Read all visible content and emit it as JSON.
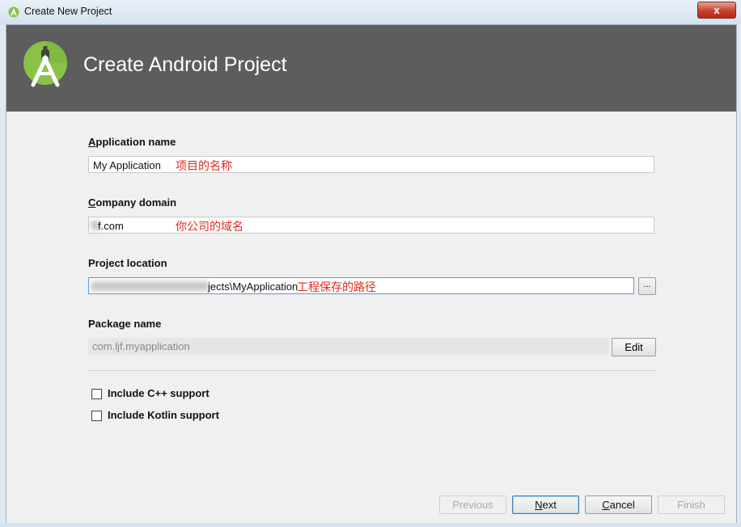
{
  "window": {
    "title": "Create New Project",
    "close_label": "x"
  },
  "header": {
    "title": "Create Android Project"
  },
  "form": {
    "application_name": {
      "label_mnemonic": "A",
      "label_rest": "pplication name",
      "value": "My Application",
      "annotation": "项目的名称"
    },
    "company_domain": {
      "label_mnemonic": "C",
      "label_rest": "ompany domain",
      "value": "f.com",
      "annotation": "你公司的域名"
    },
    "project_location": {
      "label": "Project location",
      "value": "jects\\MyApplication",
      "annotation": "工程保存的路径",
      "browse_label": "..."
    },
    "package_name": {
      "label": "Package name",
      "value": "com.ljf.myapplication",
      "edit_label": "Edit"
    },
    "options": [
      {
        "label": "Include C++ support",
        "checked": false
      },
      {
        "label": "Include Kotlin support",
        "checked": false
      }
    ]
  },
  "buttons": {
    "previous": "Previous",
    "next_mnemonic": "N",
    "next_rest": "ext",
    "cancel_mnemonic": "C",
    "cancel_rest": "ancel",
    "finish": "Finish"
  },
  "colors": {
    "header_bg": "#5d5d5d",
    "logo_green": "#8ac249",
    "annotation_red": "#e22a1c"
  },
  "icons": {
    "app": "android-studio-icon",
    "logo": "android-studio-logo"
  }
}
